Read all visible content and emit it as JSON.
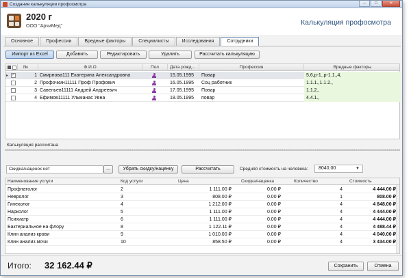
{
  "window": {
    "title": "Создание калькуляции профосмотра"
  },
  "header": {
    "year": "2020 г",
    "organization": "ООО \"АрчиМед\"",
    "document_title": "Калькуляция профосмотра"
  },
  "tabs": [
    {
      "label": "Основное"
    },
    {
      "label": "Профессии"
    },
    {
      "label": "Вредные факторы"
    },
    {
      "label": "Специалисты"
    },
    {
      "label": "Исследования"
    },
    {
      "label": "Сотрудники",
      "active": true
    }
  ],
  "toolbar": {
    "import_label": "Импорт из Excel",
    "add_label": "Добавить",
    "edit_label": "Редактировать",
    "delete_label": "Удалить",
    "calculate_label": "Рассчитать калькуляцию"
  },
  "employees": {
    "columns": {
      "num": "№",
      "fio": "Ф.И.О",
      "sex": "Пол",
      "birth": "Дата рожд...",
      "profession": "Профессия",
      "factors": "Вредные факторы"
    },
    "rows": [
      {
        "num": "1",
        "fio": "Смирнова111 Екатерина Александровна",
        "birth": "15.05.1995",
        "profession": "Повар",
        "factors": "5,6,р-1.,р-1.1.,4,",
        "checked": true,
        "selected": true
      },
      {
        "num": "2",
        "fio": "Профочкин11111 Проф Профович",
        "birth": "16.05.1995",
        "profession": "Соц работник",
        "factors": "1.1.1.,1.1.2.,",
        "checked": false,
        "selected": false
      },
      {
        "num": "3",
        "fio": "Савельев11111 Андрей Андреевич",
        "birth": "17.05.1995",
        "profession": "Повар",
        "factors": "1.1.2.,",
        "checked": false,
        "selected": false
      },
      {
        "num": "4",
        "fio": "Ефимов11111 Ульманас Увна",
        "birth": "18.05.1995",
        "profession": "повар",
        "factors": "4.4.1.,",
        "checked": false,
        "selected": false
      }
    ]
  },
  "status_text": "Калькуляция рассчитана",
  "calc": {
    "discount_text": "Скидка/наценок нет",
    "ellipsis_label": "...",
    "remove_discount_label": "Убрать скидку/наценку",
    "recalc_label": "Рассчитать",
    "avg_label": "Средняя стоимость на человека:",
    "avg_value": "8040.00"
  },
  "services": {
    "columns": {
      "name": "Наименование услуги",
      "code": "Код услуги",
      "price": "Цена",
      "discount": "Скидка/наценка",
      "qty": "Количество",
      "cost": "Стоимость"
    },
    "rows": [
      {
        "name": "Профпатолог",
        "code": "2",
        "price": "1 111.00 ₽",
        "discount": "0.00 ₽",
        "qty": "4",
        "cost": "4 444.00 ₽"
      },
      {
        "name": "Невролог",
        "code": "3",
        "price": "808.00 ₽",
        "discount": "0.00 ₽",
        "qty": "1",
        "cost": "808.00 ₽"
      },
      {
        "name": "Гинеколог",
        "code": "4",
        "price": "1 212.00 ₽",
        "discount": "0.00 ₽",
        "qty": "4",
        "cost": "4 848.00 ₽"
      },
      {
        "name": "Нарколог",
        "code": "5",
        "price": "1 111.00 ₽",
        "discount": "0.00 ₽",
        "qty": "4",
        "cost": "4 444.00 ₽"
      },
      {
        "name": "Психиатр",
        "code": "6",
        "price": "1 111.00 ₽",
        "discount": "0.00 ₽",
        "qty": "4",
        "cost": "4 444.00 ₽"
      },
      {
        "name": "Бактериальное на флору",
        "code": "8",
        "price": "1 122.11 ₽",
        "discount": "0.00 ₽",
        "qty": "4",
        "cost": "4 488.44 ₽"
      },
      {
        "name": "Клин анализ крови",
        "code": "9",
        "price": "1 010.00 ₽",
        "discount": "0.00 ₽",
        "qty": "4",
        "cost": "4 040.00 ₽"
      },
      {
        "name": "Клин анализ мочи",
        "code": "10",
        "price": "858.50 ₽",
        "discount": "0.00 ₽",
        "qty": "4",
        "cost": "3 434.00 ₽"
      }
    ]
  },
  "footer": {
    "total_label": "Итого:",
    "total_value": "32 162.44 ₽",
    "save_label": "Сохранить",
    "cancel_label": "Отмена"
  },
  "colors": {
    "accent": "#2c5280",
    "factors_bg": "#e9f7df",
    "person_icon": "#8a3aa0"
  }
}
